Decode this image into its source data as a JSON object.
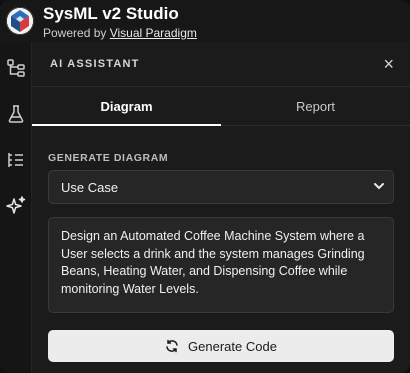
{
  "app": {
    "title": "SysML v2 Studio",
    "powered_prefix": "Powered by ",
    "powered_link": "Visual Paradigm"
  },
  "rail": {
    "items": [
      {
        "icon": "tree-structure-icon"
      },
      {
        "icon": "flask-icon"
      },
      {
        "icon": "outline-list-icon"
      },
      {
        "icon": "sparkle-icon"
      }
    ]
  },
  "panel": {
    "title": "AI ASSISTANT",
    "close_label": "×",
    "tabs": [
      {
        "label": "Diagram",
        "active": true
      },
      {
        "label": "Report",
        "active": false
      }
    ],
    "section_label": "GENERATE DIAGRAM",
    "diagram_type": "Use Case",
    "prompt_text": "Design an Automated Coffee Machine System where a User selects a drink and the system manages Grinding Beans, Heating Water, and Dispensing Coffee while monitoring Water Levels.",
    "generate_button": "Generate Code"
  },
  "colors": {
    "background": "#141414",
    "panel": "#1b1b1b",
    "button": "#ececec",
    "accent_red": "#d63a3a"
  }
}
